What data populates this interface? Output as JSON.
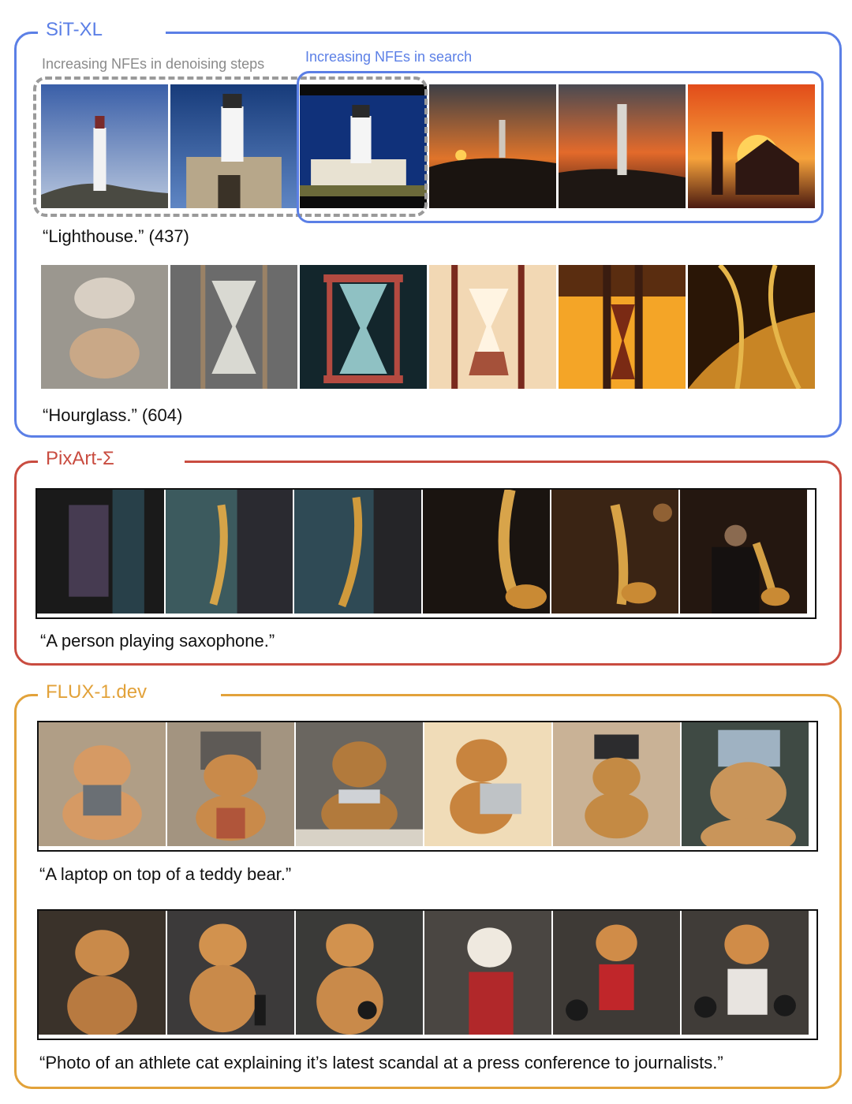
{
  "groups": {
    "sit": {
      "title": "SiT-XL",
      "sub_denoise": "Increasing NFEs in denoising steps",
      "sub_search": "Increasing NFEs in search",
      "caption_1": "“Lighthouse.” (437)",
      "caption_2": "“Hourglass.” (604)"
    },
    "pixart": {
      "title": "PixArt-Σ",
      "caption_1": "“A person playing saxophone.”"
    },
    "flux": {
      "title": "FLUX-1.dev",
      "caption_1": "“A laptop on top of a teddy bear.”",
      "caption_2": "“Photo of an athlete cat explaining it’s latest scandal at a press conference to journalists.”"
    }
  },
  "colors": {
    "sit_border": "#5b7fe6",
    "pixart_border": "#c94c40",
    "flux_border": "#e2a23a",
    "dashed_border": "#9a9a9a"
  }
}
